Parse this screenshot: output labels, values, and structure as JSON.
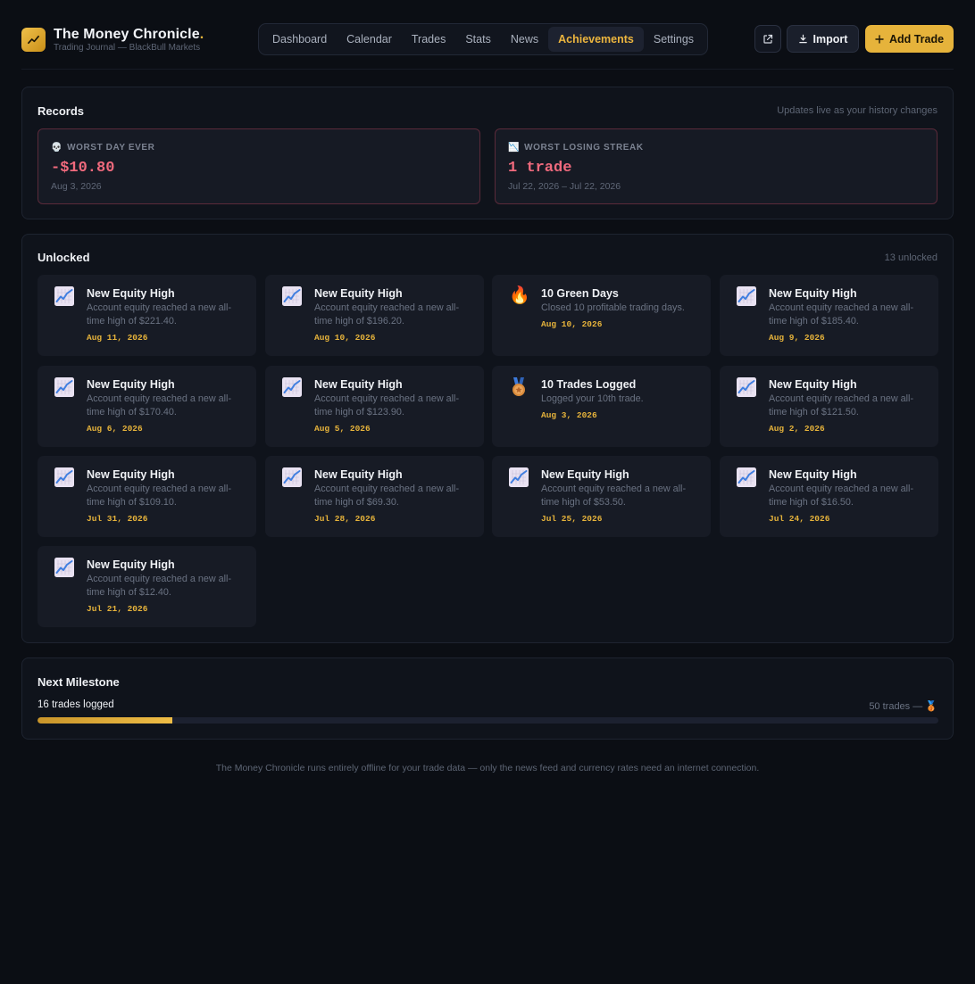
{
  "brand": {
    "title": "The Money Chronicle",
    "title_dot": ".",
    "subtitle": "Trading Journal — BlackBull Markets",
    "accent": "#e6b33b"
  },
  "nav": {
    "items": [
      {
        "label": "Dashboard",
        "active": false
      },
      {
        "label": "Calendar",
        "active": false
      },
      {
        "label": "Trades",
        "active": false
      },
      {
        "label": "Stats",
        "active": false
      },
      {
        "label": "News",
        "active": false
      },
      {
        "label": "Achievements",
        "active": true
      },
      {
        "label": "Settings",
        "active": false
      }
    ]
  },
  "toolbar": {
    "external_icon": "external-link-icon",
    "import_label": "Import",
    "add_trade_label": "Add Trade"
  },
  "records": {
    "title": "Records",
    "note": "Updates live as your history changes",
    "cards": [
      {
        "icon": "💀",
        "label": "WORST DAY EVER",
        "value": "-$10.80",
        "date": "Aug 3, 2026"
      },
      {
        "icon": "📉",
        "label": "WORST LOSING STREAK",
        "value": "1 trade",
        "date": "Jul 22, 2026 – Jul 22, 2026"
      }
    ]
  },
  "unlocked": {
    "title": "Unlocked",
    "count_note": "13 unlocked",
    "items": [
      {
        "icon": "chart-up-icon",
        "title": "New Equity High",
        "desc": "Account equity reached a new all-time high of $221.40.",
        "date": "Aug 11, 2026"
      },
      {
        "icon": "chart-up-icon",
        "title": "New Equity High",
        "desc": "Account equity reached a new all-time high of $196.20.",
        "date": "Aug 10, 2026"
      },
      {
        "icon": "fire-icon",
        "title": "10 Green Days",
        "desc": "Closed 10 profitable trading days.",
        "date": "Aug 10, 2026"
      },
      {
        "icon": "chart-up-icon",
        "title": "New Equity High",
        "desc": "Account equity reached a new all-time high of $185.40.",
        "date": "Aug 9, 2026"
      },
      {
        "icon": "chart-up-icon",
        "title": "New Equity High",
        "desc": "Account equity reached a new all-time high of $170.40.",
        "date": "Aug 6, 2026"
      },
      {
        "icon": "chart-up-icon",
        "title": "New Equity High",
        "desc": "Account equity reached a new all-time high of $123.90.",
        "date": "Aug 5, 2026"
      },
      {
        "icon": "medal-icon",
        "title": "10 Trades Logged",
        "desc": "Logged your 10th trade.",
        "date": "Aug 3, 2026"
      },
      {
        "icon": "chart-up-icon",
        "title": "New Equity High",
        "desc": "Account equity reached a new all-time high of $121.50.",
        "date": "Aug 2, 2026"
      },
      {
        "icon": "chart-up-icon",
        "title": "New Equity High",
        "desc": "Account equity reached a new all-time high of $109.10.",
        "date": "Jul 31, 2026"
      },
      {
        "icon": "chart-up-icon",
        "title": "New Equity High",
        "desc": "Account equity reached a new all-time high of $69.30.",
        "date": "Jul 28, 2026"
      },
      {
        "icon": "chart-up-icon",
        "title": "New Equity High",
        "desc": "Account equity reached a new all-time high of $53.50.",
        "date": "Jul 25, 2026"
      },
      {
        "icon": "chart-up-icon",
        "title": "New Equity High",
        "desc": "Account equity reached a new all-time high of $16.50.",
        "date": "Jul 24, 2026"
      },
      {
        "icon": "chart-up-icon",
        "title": "New Equity High",
        "desc": "Account equity reached a new all-time high of $12.40.",
        "date": "Jul 21, 2026"
      }
    ]
  },
  "milestone": {
    "title": "Next Milestone",
    "progress_label": "16 trades logged",
    "goal_label": "50 trades —",
    "goal_icon": "🥉",
    "progress_fraction": 0.15
  },
  "footer": {
    "text": "The Money Chronicle runs entirely offline for your trade data — only the news feed and currency rates need an internet connection."
  }
}
